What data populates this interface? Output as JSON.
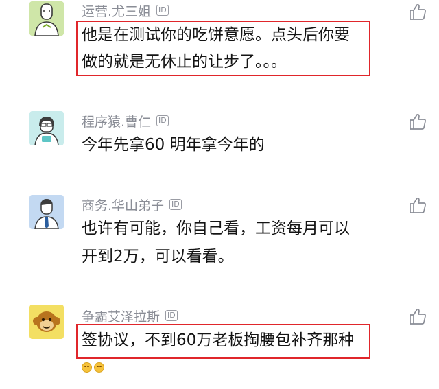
{
  "comments": [
    {
      "user": "运营.尤三姐",
      "badge": "ID",
      "lines": [
        "他是在测试你的吃饼意愿。点头后你要",
        "做的就是无休止的让步了。。。"
      ],
      "avatar_icon": "clerk-avatar-icon",
      "highlighted": true
    },
    {
      "user": "程序猿.曹仁",
      "badge": "ID",
      "lines": [
        "今年先拿60 明年拿今年的"
      ],
      "avatar_icon": "programmer-avatar-icon",
      "highlighted": false
    },
    {
      "user": "商务.华山弟子",
      "badge": "ID",
      "lines": [
        "也许有可能，你自己看，工资每月可以",
        "开到2万，可以看看。"
      ],
      "avatar_icon": "business-avatar-icon",
      "highlighted": false
    },
    {
      "user": "争霸艾泽拉斯",
      "badge": "ID",
      "lines": [
        "签协议，不到60万老板掏腰包补齐那种"
      ],
      "avatar_icon": "monkey-avatar-icon",
      "highlighted": true,
      "emojis": [
        "laughing-emoji-icon",
        "laughing-emoji-icon"
      ]
    }
  ],
  "colors": {
    "highlight_border": "#e0262b",
    "username": "#8a8d96",
    "text": "#141414"
  },
  "icons": {
    "like": "thumbs-up-icon"
  }
}
